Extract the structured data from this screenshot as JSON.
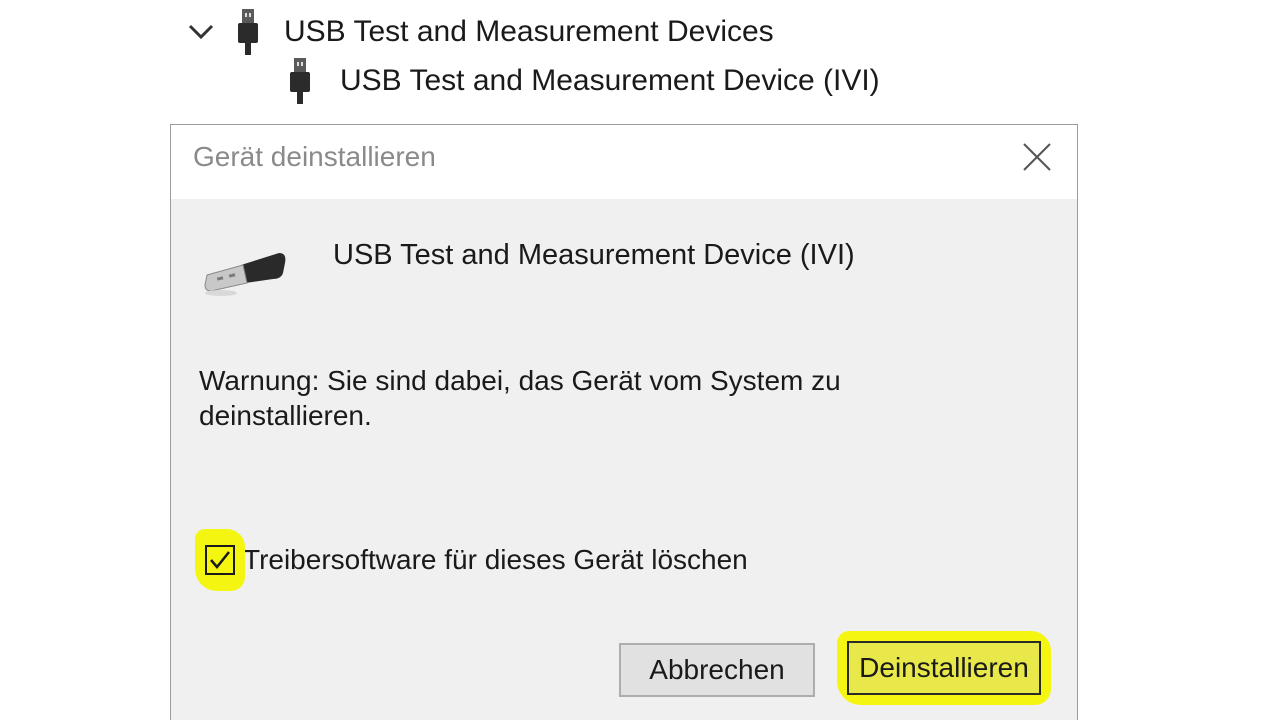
{
  "tree": {
    "category_label": "USB Test and Measurement Devices",
    "device_label": "USB Test and Measurement Device (IVI)"
  },
  "dialog": {
    "title": "Gerät deinstallieren",
    "device_name": "USB Test and Measurement Device (IVI)",
    "warning": "Warnung: Sie sind dabei, das Gerät vom System zu deinstallieren.",
    "checkbox_label": "Treibersoftware für dieses Gerät löschen",
    "checkbox_checked": true,
    "cancel_label": "Abbrechen",
    "uninstall_label": "Deinstallieren"
  },
  "colors": {
    "highlight": "#f5f512",
    "dialog_bg": "#f0f0f0",
    "title_text": "#8a8a8a"
  },
  "icons": {
    "expand": "chevron-down-icon",
    "usb": "usb-plug-icon",
    "close": "close-icon",
    "device": "usb-cable-icon",
    "check": "checkmark-icon"
  }
}
